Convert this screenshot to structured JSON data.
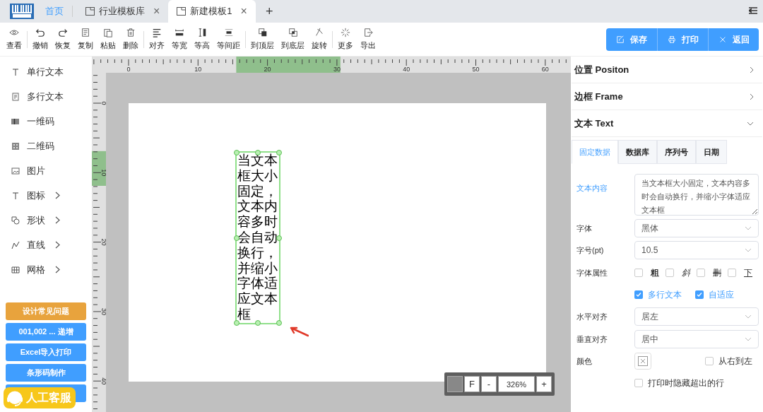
{
  "app_tabs": [
    {
      "label": "首页",
      "kind": "home",
      "selected": false
    },
    {
      "label": "行业模板库",
      "kind": "page",
      "selected": false,
      "close": "×"
    },
    {
      "label": "新建模板1",
      "kind": "page",
      "selected": true,
      "close": "×"
    }
  ],
  "new_tab": "+",
  "toolbar": [
    [
      {
        "label": "查看"
      }
    ],
    [
      {
        "label": "撤销"
      },
      {
        "label": "恢复"
      },
      {
        "label": "复制"
      },
      {
        "label": "粘贴"
      },
      {
        "label": "删除"
      }
    ],
    [
      {
        "label": "对齐"
      },
      {
        "label": "等宽"
      },
      {
        "label": "等高"
      },
      {
        "label": "等间距"
      }
    ],
    [
      {
        "label": "到顶层"
      },
      {
        "label": "到底层"
      },
      {
        "label": "旋转"
      }
    ],
    [
      {
        "label": "更多"
      },
      {
        "label": "导出"
      }
    ]
  ],
  "actions": [
    {
      "label": "保存"
    },
    {
      "label": "打印"
    },
    {
      "label": "返回"
    }
  ],
  "sidebar": {
    "items": [
      {
        "label": "单行文本",
        "submenu": false
      },
      {
        "label": "多行文本",
        "submenu": false
      },
      {
        "label": "一维码",
        "submenu": false
      },
      {
        "label": "二维码",
        "submenu": false
      },
      {
        "label": "图片",
        "submenu": false
      },
      {
        "label": "图标",
        "submenu": true
      },
      {
        "label": "形状",
        "submenu": true
      },
      {
        "label": "直线",
        "submenu": true
      },
      {
        "label": "网格",
        "submenu": true
      }
    ],
    "buttons": [
      {
        "label": "设计常见问题",
        "color": "#e8a33d"
      },
      {
        "label": "001,002 ... 递增",
        "color": "#409eff"
      },
      {
        "label": "Excel导入打印",
        "color": "#409eff"
      },
      {
        "label": "条形码制作",
        "color": "#409eff"
      },
      {
        "color": "#409eff"
      }
    ],
    "support_badge": "人工客服"
  },
  "ruler": {
    "x_labels": [
      "0",
      "10",
      "20",
      "30",
      "40",
      "50",
      "60"
    ],
    "y_labels": [
      "0",
      "10",
      "20",
      "30",
      "40"
    ]
  },
  "canvas": {
    "text_box": "当文本框大小固定，文本内容多时会自动换行，并缩小字体适应文本框",
    "selected": true,
    "zoom": {
      "fit": "F",
      "minus": "-",
      "value": "326%",
      "plus": "+"
    }
  },
  "panel": {
    "sections": [
      {
        "title": "位置 Positon",
        "expanded": false
      },
      {
        "title": "边框 Frame",
        "expanded": false
      },
      {
        "title": "文本 Text",
        "expanded": true
      }
    ],
    "tabs": [
      {
        "label": "固定数据",
        "selected": true
      },
      {
        "label": "数据库",
        "selected": false
      },
      {
        "label": "序列号",
        "selected": false
      },
      {
        "label": "日期",
        "selected": false
      }
    ],
    "content_label": "文本内容",
    "content": "当文本框大小固定，文本内容多时会自动换行，并缩小字体适应文本框",
    "font_label": "字体",
    "font": "黑体",
    "size_label": "字号(pt)",
    "size": "10.5",
    "style_label": "字体属性",
    "styles": [
      {
        "label": "粗",
        "checked": false
      },
      {
        "label": "斜",
        "checked": false
      },
      {
        "label": "删",
        "checked": false
      },
      {
        "label": "下",
        "checked": false
      }
    ],
    "options": [
      {
        "label": "多行文本",
        "checked": true
      },
      {
        "label": "自适应",
        "checked": true
      }
    ],
    "halign_label": "水平对齐",
    "halign": "居左",
    "valign_label": "垂直对齐",
    "valign": "居中",
    "color_label": "颜色",
    "rtl": {
      "label": "从右到左",
      "checked": false
    },
    "hide_overflow": {
      "label": "打印时隐藏超出的行",
      "checked": false
    }
  }
}
